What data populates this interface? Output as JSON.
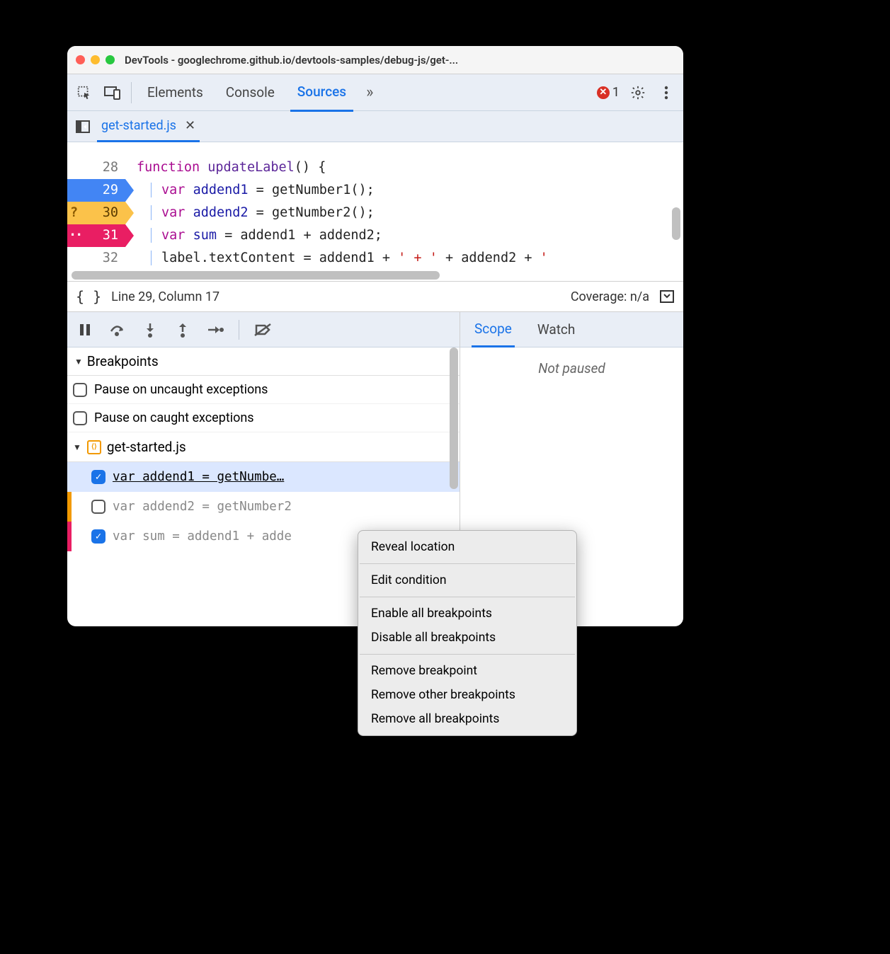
{
  "window": {
    "title": "DevTools - googlechrome.github.io/devtools-samples/debug-js/get-..."
  },
  "tabs": {
    "elements": "Elements",
    "console": "Console",
    "sources": "Sources",
    "more": "»",
    "error_count": "1"
  },
  "file_tab": {
    "name": "get-started.js"
  },
  "code": {
    "lines": [
      {
        "num": "28",
        "bp": "",
        "tokens": [
          "function ",
          "updateLabel",
          "() {"
        ]
      },
      {
        "num": "29",
        "bp": "blue",
        "tokens": [
          "var ",
          "addend1",
          " = ",
          "getNumber1",
          "();"
        ]
      },
      {
        "num": "30",
        "bp": "orange",
        "mark": "?",
        "tokens": [
          "var ",
          "addend2",
          " = ",
          "getNumber2",
          "();"
        ]
      },
      {
        "num": "31",
        "bp": "pink",
        "mark": "··",
        "tokens": [
          "var ",
          "sum",
          " = addend1 + addend2;"
        ]
      },
      {
        "num": "32",
        "bp": "",
        "tokens": [
          "label.textContent = addend1 + ",
          "' + '",
          " + addend2 + ",
          "'"
        ]
      }
    ]
  },
  "statusbar": {
    "position": "Line 29, Column 17",
    "coverage": "Coverage: n/a"
  },
  "breakpoints": {
    "header": "Breakpoints",
    "pause_uncaught": "Pause on uncaught exceptions",
    "pause_caught": "Pause on caught exceptions",
    "file": "get-started.js",
    "items": [
      {
        "checked": true,
        "text": "var addend1 = getNumbe…",
        "color": "",
        "selected": true
      },
      {
        "checked": false,
        "text": "var addend2 = getNumber2",
        "color": "#f29900",
        "selected": false
      },
      {
        "checked": true,
        "text": "var sum = addend1 + adde",
        "color": "#e91e63",
        "selected": false
      }
    ]
  },
  "right_panel": {
    "scope": "Scope",
    "watch": "Watch",
    "not_paused": "Not paused"
  },
  "context_menu": {
    "reveal": "Reveal location",
    "edit": "Edit condition",
    "enable_all": "Enable all breakpoints",
    "disable_all": "Disable all breakpoints",
    "remove": "Remove breakpoint",
    "remove_other": "Remove other breakpoints",
    "remove_all": "Remove all breakpoints"
  }
}
